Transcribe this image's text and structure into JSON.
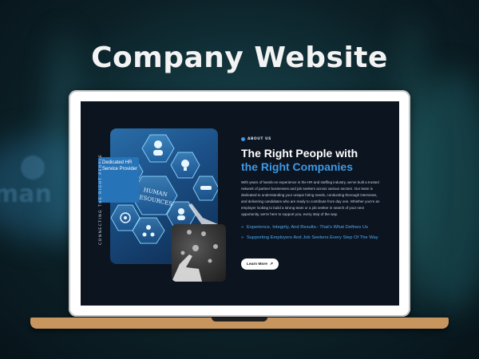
{
  "promo": {
    "headline": "Company Website",
    "background_word": "man"
  },
  "site": {
    "image_card": {
      "badge_label": "Dedicated HR Service Provider",
      "vertical_text": "CONNECTING THE RIGHT PEOPLE",
      "hexagon_center_label_line1": "HUMAN",
      "hexagon_center_label_line2": "RESOURCES"
    },
    "about": {
      "tag": "ABOUT US",
      "title_line1": "The Right People with",
      "title_line2": "the Right Companies",
      "paragraph": "With years of hands-on experience in the HR and staffing industry, we've built a trusted network of partner businesses and job seekers across various sectors. Our team is dedicated to understanding your unique hiring needs, conducting thorough interviews, and delivering candidates who are ready to contribute from day one. Whether you're an employer looking to build a strong team or a job seeker in search of your next opportunity, we're here to support you, every step of the way.",
      "bullets": [
        "Experience, Integrity, And Results– That's What Defines Us",
        "Supporting Employers And Job Seekers Every Step Of The Way"
      ],
      "cta_label": "Learn More"
    }
  },
  "colors": {
    "accent": "#3c9ae6",
    "screen_bg": "#0c1420",
    "laptop_base": "#c9955f"
  }
}
